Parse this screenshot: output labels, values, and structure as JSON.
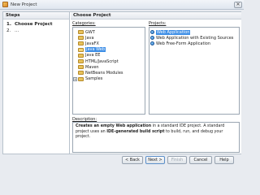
{
  "window": {
    "title": "New Project",
    "close_label": "✕"
  },
  "steps": {
    "header": "Steps",
    "items": [
      {
        "num": "1.",
        "label": "Choose Project"
      },
      {
        "num": "2.",
        "label": "..."
      }
    ]
  },
  "content": {
    "header": "Choose Project",
    "categories_label": "Categories:",
    "projects_label": "Projects:",
    "description_label": "Description:",
    "categories": [
      {
        "label": "GWT",
        "expander": "",
        "selected": false
      },
      {
        "label": "Java",
        "expander": "",
        "selected": false
      },
      {
        "label": "JavaFX",
        "expander": "",
        "selected": false
      },
      {
        "label": "Java Web",
        "expander": "",
        "selected": true
      },
      {
        "label": "Java EE",
        "expander": "",
        "selected": false
      },
      {
        "label": "HTML/JavaScript",
        "expander": "",
        "selected": false
      },
      {
        "label": "Maven",
        "expander": "",
        "selected": false
      },
      {
        "label": "NetBeans Modules",
        "expander": "",
        "selected": false
      },
      {
        "label": "Samples",
        "expander": "+",
        "selected": false
      }
    ],
    "projects": [
      {
        "label": "Web Application",
        "selected": true
      },
      {
        "label": "Web Application with Existing Sources",
        "selected": false
      },
      {
        "label": "Web Free-Form Application",
        "selected": false
      }
    ],
    "description": {
      "bold1": "Creates an empty Web application",
      "text1": " in a standard IDE project. A standard project uses an ",
      "bold2": "IDE-generated build script",
      "text2": " to build, run, and debug your project."
    }
  },
  "buttons": {
    "back": "< Back",
    "next": "Next >",
    "finish": "Finish",
    "cancel": "Cancel",
    "help": "Help"
  },
  "colors": {
    "selection": "#3d8ee6",
    "accent_border": "#5c8fc9"
  },
  "icons": {
    "folder": "folder-icon",
    "project": "globe-icon",
    "app": "app-icon"
  }
}
